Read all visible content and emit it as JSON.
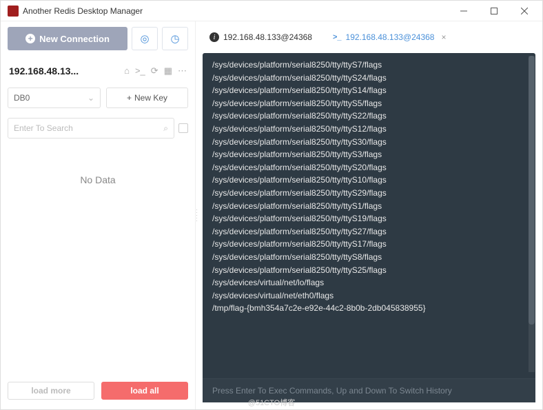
{
  "window": {
    "title": "Another Redis Desktop Manager"
  },
  "sidebar": {
    "new_connection": "New Connection",
    "connection_name": "192.168.48.13...",
    "db_label": "DB0",
    "new_key": "New Key",
    "search_placeholder": "Enter To Search",
    "no_data": "No Data",
    "load_more": "load more",
    "load_all": "load all"
  },
  "tabs": {
    "info": "192.168.48.133@24368",
    "cli": "192.168.48.133@24368"
  },
  "console": {
    "lines": [
      "/sys/devices/platform/serial8250/tty/ttyS7/flags",
      "/sys/devices/platform/serial8250/tty/ttyS24/flags",
      "/sys/devices/platform/serial8250/tty/ttyS14/flags",
      "/sys/devices/platform/serial8250/tty/ttyS5/flags",
      "/sys/devices/platform/serial8250/tty/ttyS22/flags",
      "/sys/devices/platform/serial8250/tty/ttyS12/flags",
      "/sys/devices/platform/serial8250/tty/ttyS30/flags",
      "/sys/devices/platform/serial8250/tty/ttyS3/flags",
      "/sys/devices/platform/serial8250/tty/ttyS20/flags",
      "/sys/devices/platform/serial8250/tty/ttyS10/flags",
      "/sys/devices/platform/serial8250/tty/ttyS29/flags",
      "/sys/devices/platform/serial8250/tty/ttyS1/flags",
      "/sys/devices/platform/serial8250/tty/ttyS19/flags",
      "/sys/devices/platform/serial8250/tty/ttyS27/flags",
      "/sys/devices/platform/serial8250/tty/ttyS17/flags",
      "/sys/devices/platform/serial8250/tty/ttyS8/flags",
      "/sys/devices/platform/serial8250/tty/ttyS25/flags",
      "/sys/devices/virtual/net/lo/flags",
      "/sys/devices/virtual/net/eth0/flags",
      "/tmp/flag-{bmh354a7c2e-e92e-44c2-8b0b-2db045838955}"
    ],
    "input_placeholder": "Press Enter To Exec Commands, Up and Down To Switch History"
  },
  "watermark": "@51CTO博客"
}
